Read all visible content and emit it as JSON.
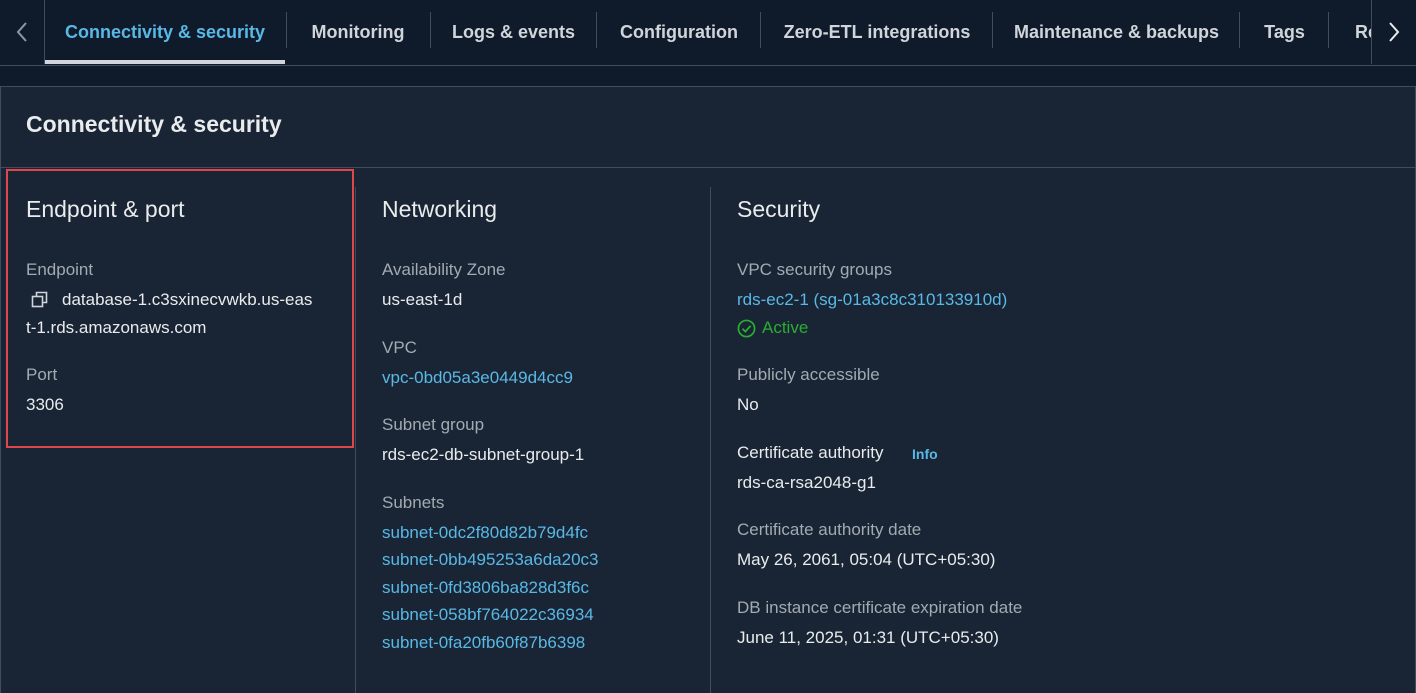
{
  "tabs": {
    "items": [
      {
        "label": "Connectivity & security"
      },
      {
        "label": "Monitoring"
      },
      {
        "label": "Logs & events"
      },
      {
        "label": "Configuration"
      },
      {
        "label": "Zero-ETL integrations"
      },
      {
        "label": "Maintenance & backups"
      },
      {
        "label": "Tags"
      },
      {
        "label": "Re"
      }
    ],
    "active_index": 0
  },
  "panel": {
    "title": "Connectivity & security"
  },
  "endpoint_port": {
    "title": "Endpoint & port",
    "endpoint_label": "Endpoint",
    "endpoint_line1": "database-1.c3sxinecvwkb.us-eas",
    "endpoint_line2": "t-1.rds.amazonaws.com",
    "port_label": "Port",
    "port_value": "3306"
  },
  "networking": {
    "title": "Networking",
    "az_label": "Availability Zone",
    "az_value": "us-east-1d",
    "vpc_label": "VPC",
    "vpc_value": "vpc-0bd05a3e0449d4cc9",
    "subnet_group_label": "Subnet group",
    "subnet_group_value": "rds-ec2-db-subnet-group-1",
    "subnets_label": "Subnets",
    "subnets": [
      "subnet-0dc2f80d82b79d4fc",
      "subnet-0bb495253a6da20c3",
      "subnet-0fd3806ba828d3f6c",
      "subnet-058bf764022c36934",
      "subnet-0fa20fb60f87b6398"
    ]
  },
  "security": {
    "title": "Security",
    "vpc_sg_label": "VPC security groups",
    "vpc_sg_value": "rds-ec2-1 (sg-01a3c8c310133910d)",
    "vpc_sg_status": "Active",
    "public_label": "Publicly accessible",
    "public_value": "No",
    "ca_label": "Certificate authority",
    "ca_info": "Info",
    "ca_value": "rds-ca-rsa2048-g1",
    "ca_date_label": "Certificate authority date",
    "ca_date_value": "May 26, 2061, 05:04 (UTC+05:30)",
    "expiry_label": "DB instance certificate expiration date",
    "expiry_value": "June 11, 2025, 01:31 (UTC+05:30)"
  },
  "colors": {
    "background": "#0f1b2a",
    "panel": "#192534",
    "link": "#59b8e6",
    "success": "#29ad32",
    "highlight_border": "#e0474b"
  }
}
